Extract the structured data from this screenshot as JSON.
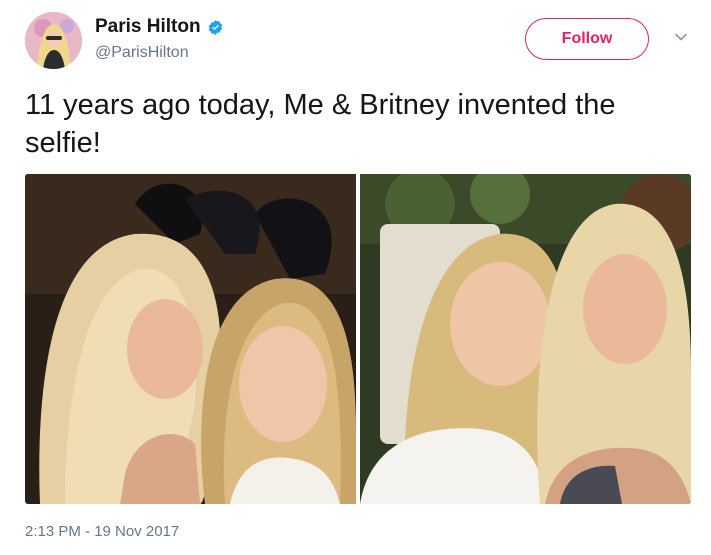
{
  "user": {
    "display_name": "Paris Hilton",
    "handle": "@ParisHilton",
    "verified": true,
    "avatar_icon": "profile-avatar"
  },
  "actions": {
    "follow_label": "Follow",
    "menu_icon": "chevron-down-icon"
  },
  "tweet": {
    "text": "11 years ago today, Me & Britney invented the selfie!",
    "timestamp": "2:13 PM - 19 Nov 2017"
  },
  "colors": {
    "accent": "#e0245e",
    "verified_blue": "#1da1f2",
    "secondary_text": "#657786"
  }
}
